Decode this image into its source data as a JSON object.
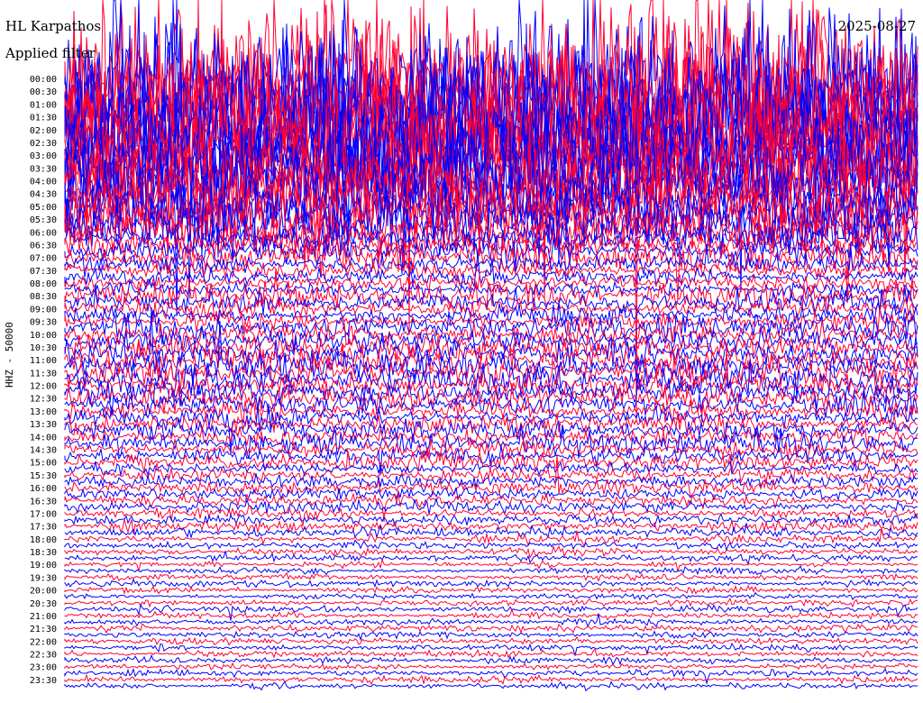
{
  "header": {
    "station": "HL Karpathos",
    "filter": "Applied filter",
    "date": "2025-08-27"
  },
  "channel_label": "HHZ - 50000",
  "colors": {
    "trace_a": "#ff0033",
    "trace_b": "#0000ff",
    "background": "#ffffff",
    "text": "#000000"
  },
  "chart_data": {
    "type": "helicorder",
    "title": "HL Karpathos",
    "ylabel": "HHZ - 50000",
    "xlabel": "",
    "row_interval_minutes": 15,
    "alternating_colors": [
      "#ff0033",
      "#0000ff"
    ],
    "time_labels": [
      "00:00",
      "00:30",
      "01:00",
      "01:30",
      "02:00",
      "02:30",
      "03:00",
      "03:30",
      "04:00",
      "04:30",
      "05:00",
      "05:30",
      "06:00",
      "06:30",
      "07:00",
      "07:30",
      "08:00",
      "08:30",
      "09:00",
      "09:30",
      "10:00",
      "10:30",
      "11:00",
      "11:30",
      "12:00",
      "12:30",
      "13:00",
      "13:30",
      "14:00",
      "14:30",
      "15:00",
      "15:30",
      "16:00",
      "16:30",
      "17:00",
      "17:30",
      "18:00",
      "18:30",
      "19:00",
      "19:30",
      "20:00",
      "20:30",
      "21:00",
      "21:30",
      "22:00",
      "22:30",
      "23:00",
      "23:30"
    ],
    "relative_amplitude_by_row": [
      14,
      14,
      14,
      13,
      13,
      13,
      12,
      12,
      12,
      11,
      11,
      10,
      10,
      10,
      9,
      9,
      8,
      8,
      8,
      7,
      7,
      6,
      6,
      5,
      3.2,
      2.4,
      2.2,
      2.0,
      2.4,
      1.6,
      1.3,
      1.6,
      1.4,
      1.1,
      2.0,
      1.8,
      1.6,
      1.4,
      1.4,
      2.0,
      1.6,
      1.5,
      2.0,
      2.4,
      2.1,
      1.9,
      2.2,
      2.0,
      1.8,
      2.2,
      1.9,
      1.7,
      1.6,
      1.6,
      1.5,
      1.6,
      1.4,
      1.6,
      1.3,
      1.2,
      1.2,
      1.1,
      1.0,
      1.0,
      1.0,
      0.9,
      1.0,
      0.9,
      0.8,
      0.8,
      0.8,
      0.8,
      0.6,
      0.55,
      0.55,
      0.55,
      0.5,
      0.5,
      0.5,
      0.5,
      0.5,
      0.5,
      0.5,
      0.5,
      0.5,
      0.5,
      0.5,
      0.5,
      0.5,
      0.5,
      0.5,
      0.5,
      0.5,
      0.5,
      0.5,
      0.5
    ]
  }
}
